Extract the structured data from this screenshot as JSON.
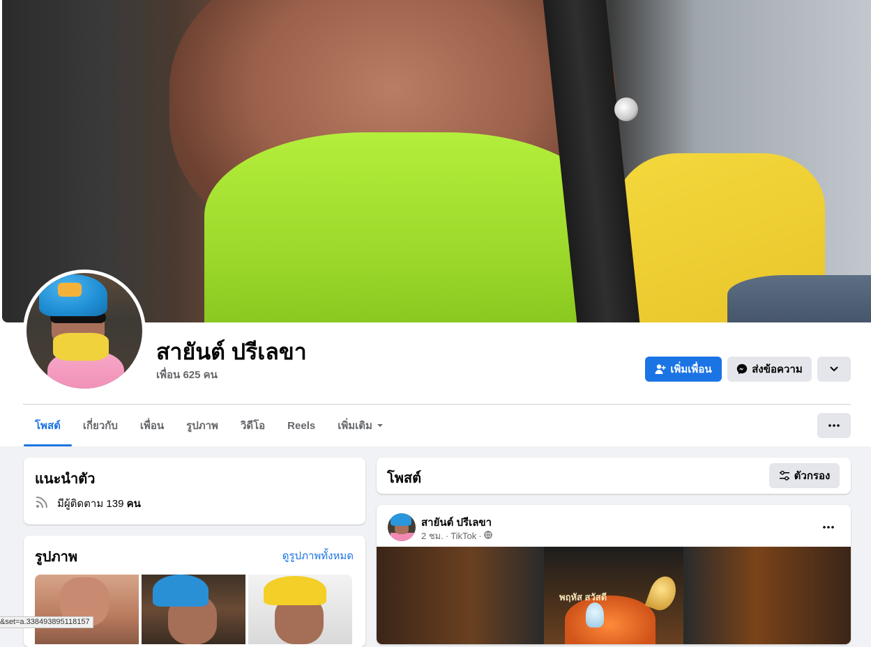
{
  "profile": {
    "name": "สายันต์ ปรีเลขา",
    "friends_count": "เพื่อน 625 คน"
  },
  "actions": {
    "add_friend": "เพิ่มเพื่อน",
    "send_message": "ส่งข้อความ"
  },
  "tabs": [
    {
      "label": "โพสต์",
      "active": true
    },
    {
      "label": "เกี่ยวกับ"
    },
    {
      "label": "เพื่อน"
    },
    {
      "label": "รูปภาพ"
    },
    {
      "label": "วิดีโอ"
    },
    {
      "label": "Reels"
    },
    {
      "label": "เพิ่มเติม"
    }
  ],
  "intro": {
    "title": "แนะนำตัว",
    "followers_prefix": "มีผู้ติดตาม",
    "followers_count": "139",
    "followers_unit": "คน"
  },
  "photos": {
    "title": "รูปภาพ",
    "see_all": "ดูรูปภาพทั้งหมด"
  },
  "posts": {
    "title": "โพสต์",
    "filter": "ตัวกรอง"
  },
  "post": {
    "author": "สายันต์ ปรีเลขา",
    "time": "2 ชม.",
    "separator": "·",
    "source": "TikTok",
    "media_caption": "พฤหัส สวัสดี"
  },
  "status_bar": {
    "url": "&set=a.338493895118157"
  },
  "colors": {
    "accent": "#1b74e4",
    "page_bg": "#f0f2f5",
    "secondary_text": "#65676b"
  },
  "icons": {
    "add_friend": "person-plus-icon",
    "messenger": "messenger-icon",
    "chevron": "chevron-down-icon",
    "more": "more-horizontal-icon",
    "filter": "sliders-icon",
    "rss": "rss-icon",
    "globe": "globe-icon"
  }
}
